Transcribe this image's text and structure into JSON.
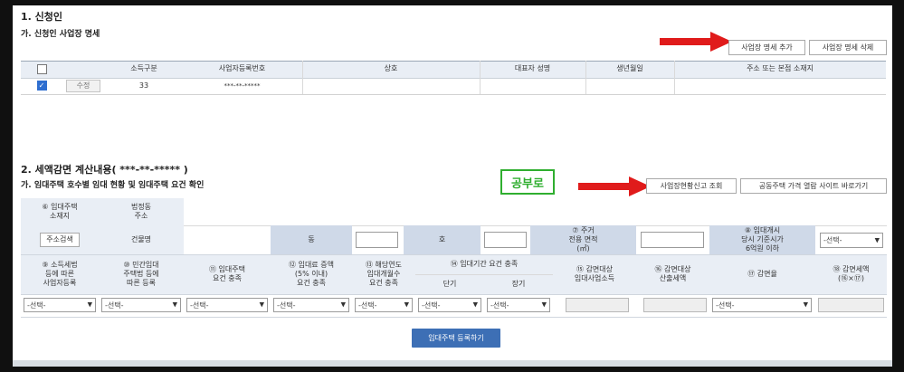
{
  "section1": {
    "title": "1. 신청인",
    "subtitle": "가. 신청인 사업장 명세",
    "add_button": "사업장 명세 추가",
    "delete_button": "사업장 명세 삭제",
    "columns": [
      "",
      "",
      "소득구분",
      "사업자등록번호",
      "상호",
      "대표자 성명",
      "생년월일",
      "주소 또는 본점 소재지"
    ],
    "rows": [
      {
        "checked": true,
        "edit_label": "수정",
        "income_type": "33",
        "biz_no": "***-**-*****",
        "name": "",
        "rep": "",
        "dob": "",
        "address": ""
      }
    ]
  },
  "section2": {
    "title": "2. 세액감면 계산내용( ***-**-***** )",
    "subtitle": "가. 임대주택 호수별 임대 현황 및 임대주택 요건 확인",
    "stamp": "공부로",
    "btn_report": "사업장현황신고 조회",
    "btn_price": "공동주택 가격 열람 사이트 바로가기",
    "row1": {
      "location": "⑥ 임대주택\n소재지",
      "legal_dong": "법정동\n주소"
    },
    "row2": {
      "addr_search": "주소검색",
      "building": "건물명",
      "dong": "동",
      "ho": "호",
      "area": "⑦ 주거\n전용 면적\n(㎡)",
      "price": "⑧ 임대개시\n당시 기준시가\n6억원 이하",
      "price_select": "-선택-"
    },
    "row3": [
      "⑨ 소득세법\n등에 따른\n사업자등록",
      "⑩ 민간임대\n주택법 등에\n따른 등록",
      "⑪ 임대주택\n요건 충족",
      "⑫ 임대료 증액\n(5% 이내)\n요건 충족",
      "⑬ 해당연도\n임대개월수\n요건 충족",
      "⑭ 임대기간 요건 충족",
      "⑮ 감면대상\n임대사업소득",
      "⑯ 감면대상\n산출세액",
      "⑰ 감면율",
      "⑱ 감면세액\n(⑯×⑰)"
    ],
    "row3_sub": [
      "단기",
      "장기"
    ],
    "selects": [
      "-선택-",
      "-선택-",
      "-선택-",
      "-선택-",
      "-선택-",
      "-선택-",
      "-선택-",
      "-선택-"
    ],
    "register_button": "임대주택 등록하기"
  },
  "colors": {
    "accent_red": "#e01b1b",
    "stamp_green": "#2fae2f",
    "header_bg": "#e9eef5",
    "blue_cell": "#cfd9e8",
    "register_btn": "#3d6fb5"
  }
}
